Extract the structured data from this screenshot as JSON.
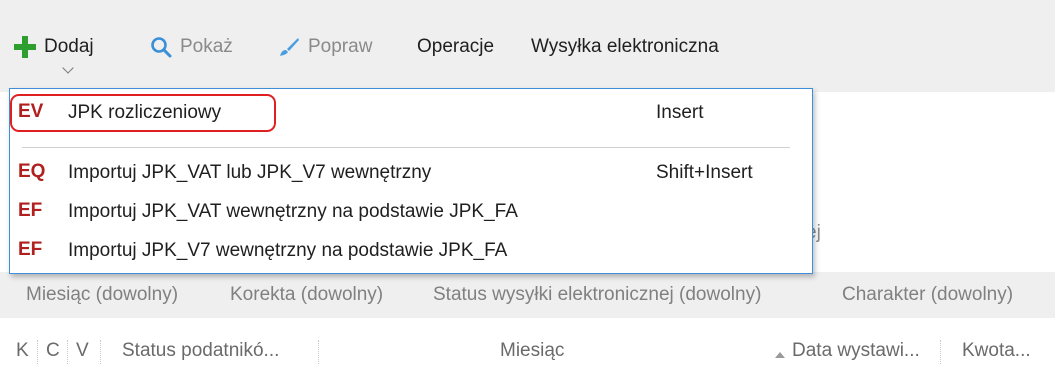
{
  "toolbar": {
    "add_label": "Dodaj",
    "show_label": "Pokaż",
    "edit_label": "Popraw",
    "operations_label": "Operacje",
    "send_label": "Wysyłka elektroniczna"
  },
  "background": {
    "partial_text": "ej"
  },
  "filters": [
    "Miesiąc (dowolny)",
    "Korekta (dowolny)",
    "Status wysyłki elektronicznej (dowolny)",
    "Charakter (dowolny)"
  ],
  "columns": [
    "K",
    "C",
    "V",
    "Status podatnikó...",
    "Miesiąc",
    "Data wystawi...",
    "Kwota..."
  ],
  "menu": {
    "items": [
      {
        "badge": "EV",
        "label": "JPK rozliczeniowy",
        "shortcut": "Insert"
      },
      {
        "badge": "EQ",
        "label": "Importuj JPK_VAT lub JPK_V7 wewnętrzny",
        "shortcut": "Shift+Insert"
      },
      {
        "badge": "EF",
        "label": "Importuj JPK_VAT wewnętrzny na podstawie JPK_FA",
        "shortcut": ""
      },
      {
        "badge": "EF",
        "label": "Importuj JPK_V7 wewnętrzny na podstawie JPK_FA",
        "shortcut": ""
      }
    ]
  },
  "colors": {
    "add_icon": "#2e9e2e",
    "search_icon": "#3a8fd6",
    "brush_icon": "#4a9ee0",
    "badge": "#b02020",
    "highlight": "#e02020",
    "menu_border": "#3f8fd8"
  },
  "icons": {
    "add": "plus-icon",
    "show": "search-icon",
    "edit": "brush-icon",
    "dropdown": "chevron-down-icon"
  }
}
